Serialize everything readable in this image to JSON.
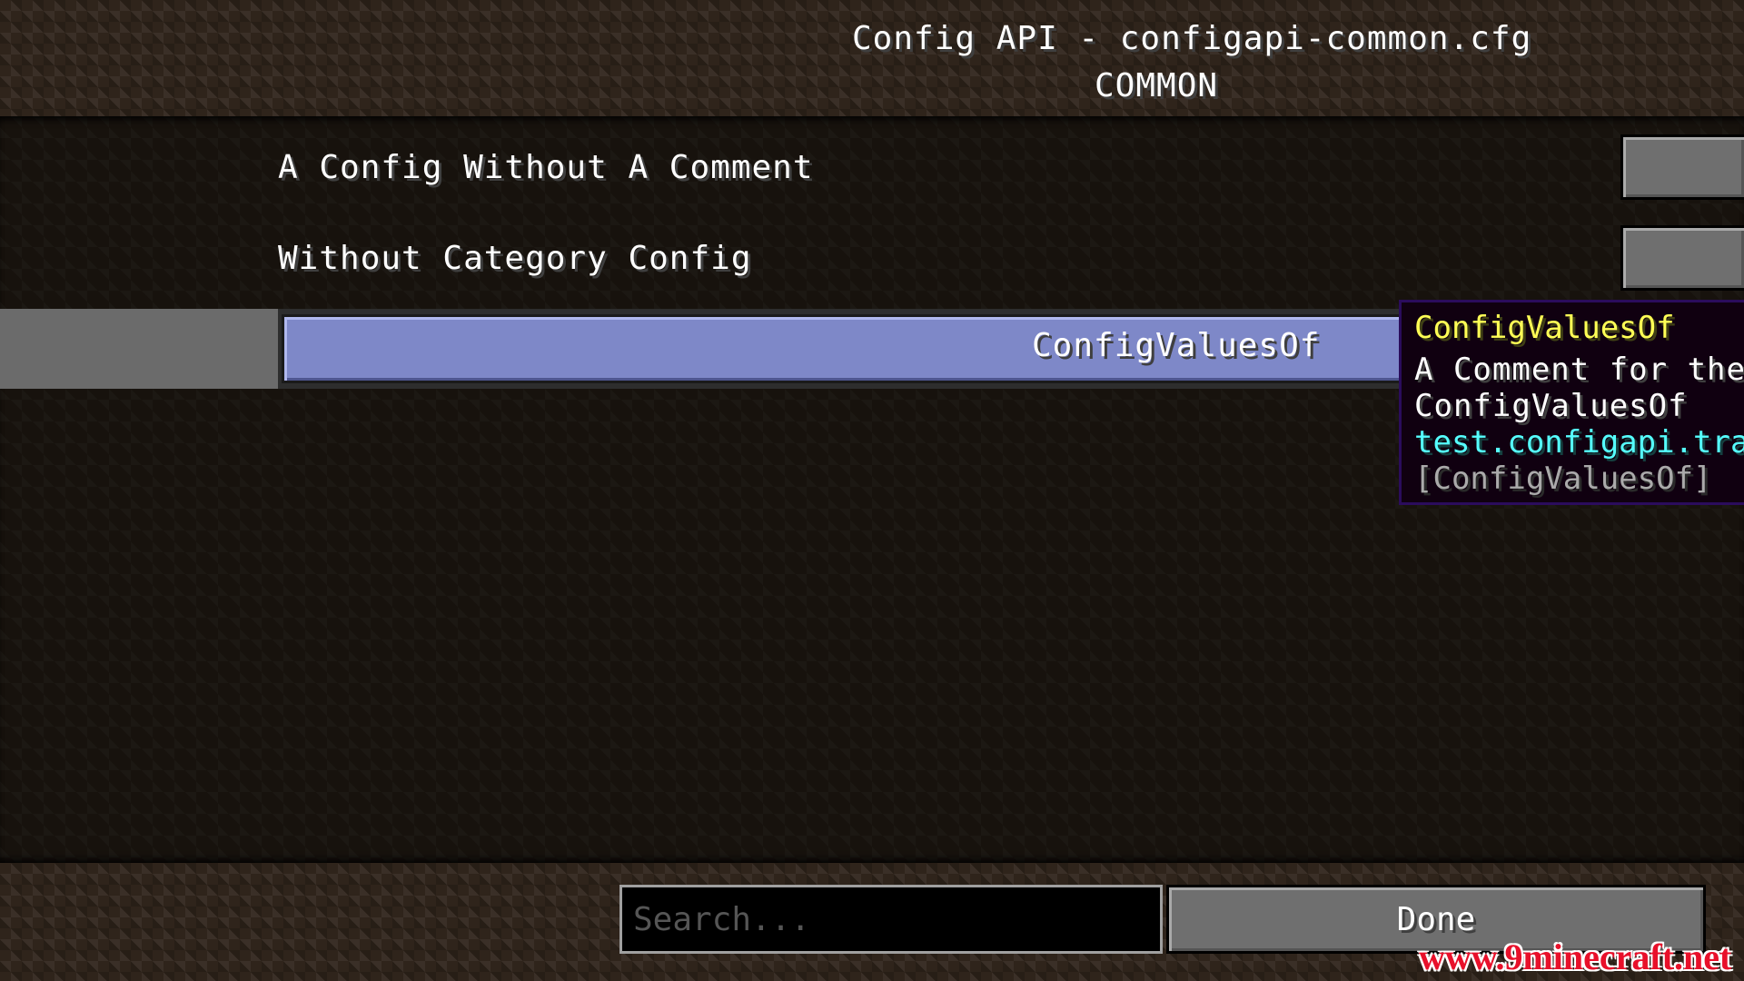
{
  "header": {
    "title": "Config API - configapi-common.cfg",
    "subtitle": "COMMON"
  },
  "entries": [
    {
      "label": "A Config Without A Comment"
    },
    {
      "label": "Without Category Config"
    },
    {
      "label": "ConfigValuesOf",
      "selected": true
    }
  ],
  "tooltip": {
    "title": "ConfigValuesOf",
    "comment_line_1": "A Comment for the",
    "comment_line_2": "ConfigValuesOf",
    "translation_key": "test.configapi.tran",
    "default_value": "[ConfigValuesOf]"
  },
  "footer": {
    "search_placeholder": "Search...",
    "done_label": "Done"
  },
  "watermark": "www.9minecraft.net",
  "colors": {
    "tooltip_title": "#ffff55",
    "tooltip_key": "#55ffff",
    "selected_entry": "#7e88c8"
  }
}
